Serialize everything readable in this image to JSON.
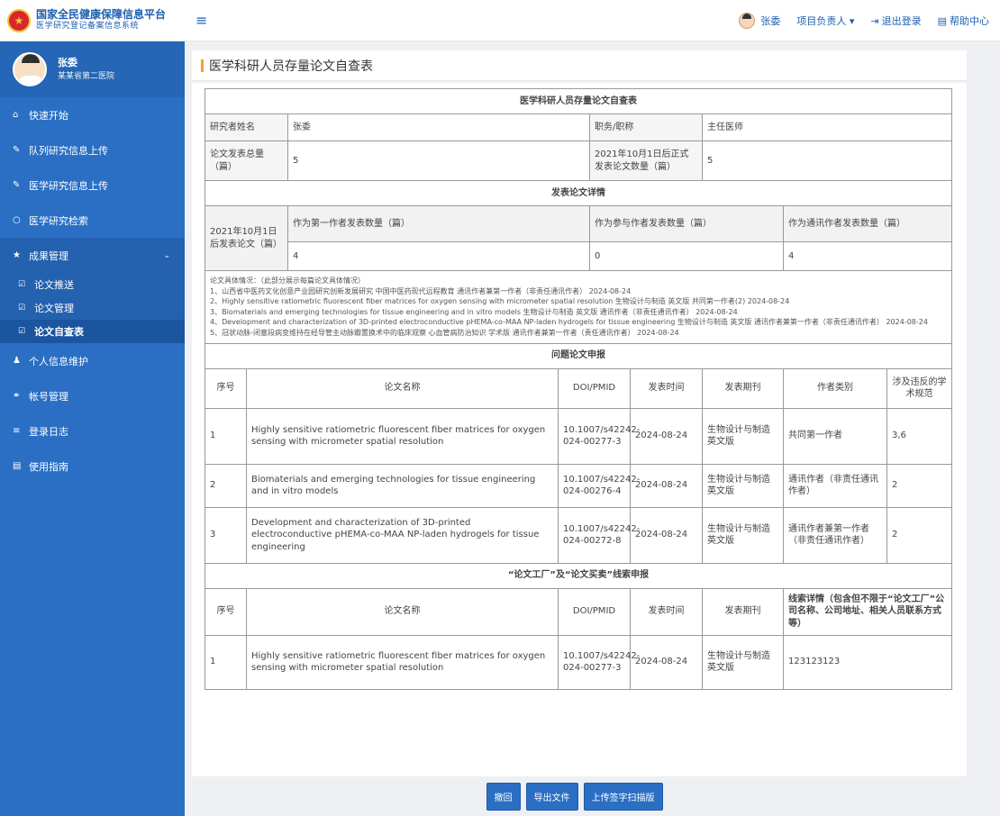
{
  "header": {
    "logo_title": "国家全民健康保障信息平台",
    "logo_sub": "医学研究登记备案信息系统",
    "user_name": "张委",
    "role_menu": "项目负责人",
    "logout": "退出登录",
    "help": "帮助中心"
  },
  "sidebar": {
    "profile_name": "张委",
    "profile_role": "某某省第二医院",
    "items": [
      {
        "label": "快速开始",
        "icon": "home-icon"
      },
      {
        "label": "队列研究信息上传",
        "icon": "pencil-icon"
      },
      {
        "label": "医学研究信息上传",
        "icon": "pencil-icon"
      },
      {
        "label": "医学研究检索",
        "icon": "circle-icon"
      },
      {
        "label": "成果管理",
        "icon": "star-icon"
      }
    ],
    "sub_items": [
      {
        "label": "论文推送"
      },
      {
        "label": "论文管理"
      },
      {
        "label": "论文自查表"
      }
    ],
    "items_after": [
      {
        "label": "个人信息维护",
        "icon": "user-icon"
      },
      {
        "label": "帐号管理",
        "icon": "users-icon"
      },
      {
        "label": "登录日志",
        "icon": "list-icon"
      },
      {
        "label": "使用指南",
        "icon": "book-icon"
      }
    ]
  },
  "page": {
    "title": "医学科研人员存量论文自查表"
  },
  "form": {
    "main_title": "医学科研人员存量论文自查表",
    "researcher_label": "研究者姓名",
    "researcher_value": "张委",
    "position_label": "职务/职称",
    "position_value": "主任医师",
    "total_label": "论文发表总量（篇）",
    "total_value": "5",
    "after_label": "2021年10月1日后正式发表论文数量（篇）",
    "after_value": "5",
    "details_title": "发表论文详情",
    "since_label": "2021年10月1日后发表论文（篇）",
    "first_author_label": "作为第一作者发表数量（篇）",
    "first_author_value": "4",
    "participant_label": "作为参与作者发表数量（篇）",
    "participant_value": "0",
    "corresponding_label": "作为通讯作者发表数量（篇）",
    "corresponding_value": "4",
    "detail_heading": "论文具体情况：（此部分展示每篇论文具体情况）",
    "detail_lines": [
      "1、山西省中医药文化创意产业园研究创新发展研究 中国中医药现代远程教育 通讯作者兼第一作者（非责任通讯作者） 2024-08-24",
      "2、Highly sensitive ratiometric fluorescent fiber matrices for oxygen sensing with micrometer spatial resolution 生物设计与制造 英文版 共同第一作者(2) 2024-08-24",
      "3、Biomaterials and emerging technologies for tissue engineering and in vitro models 生物设计与制造 英文版 通讯作者（非责任通讯作者） 2024-08-24",
      "4、Development and characterization of 3D-printed electroconductive pHEMA-co-MAA NP-laden hydrogels for tissue engineering 生物设计与制造 英文版 通讯作者兼第一作者（非责任通讯作者） 2024-08-24",
      "5、冠状动脉-闭塞段病变维持在经导管主动脉瓣置换术中的临床观察 心血管病防治知识 学术版 通讯作者兼第一作者（责任通讯作者） 2024-08-24"
    ],
    "problem_title": "问题论文申报",
    "problem_headers": [
      "序号",
      "论文名称",
      "DOI/PMID",
      "发表时间",
      "发表期刊",
      "作者类别",
      "涉及违反的学术规范"
    ],
    "problem_rows": [
      {
        "no": "1",
        "name": "Highly sensitive ratiometric fluorescent fiber matrices for oxygen sensing with micrometer spatial resolution",
        "doi": "10.1007/s42242-024-00277-3",
        "date": "2024-08-24",
        "journal": "生物设计与制造 英文版",
        "author": "共同第一作者",
        "rule": "3,6"
      },
      {
        "no": "2",
        "name": "Biomaterials and emerging technologies for tissue engineering and in vitro models",
        "doi": "10.1007/s42242-024-00276-4",
        "date": "2024-08-24",
        "journal": "生物设计与制造 英文版",
        "author": "通讯作者（非责任通讯作者）",
        "rule": "2"
      },
      {
        "no": "3",
        "name": "Development and characterization of 3D-printed electroconductive pHEMA-co-MAA NP-laden hydrogels for tissue engineering",
        "doi": "10.1007/s42242-024-00272-8",
        "date": "2024-08-24",
        "journal": "生物设计与制造 英文版",
        "author": "通讯作者兼第一作者（非责任通讯作者）",
        "rule": "2"
      }
    ],
    "clue_title": "“论文工厂”及“论文买卖”线索申报",
    "clue_headers": [
      "序号",
      "论文名称",
      "DOI/PMID",
      "发表时间",
      "发表期刊",
      "线索详情（包含但不限于“论文工厂”公司名称、公司地址、相关人员联系方式等）"
    ],
    "clue_rows": [
      {
        "no": "1",
        "name": "Highly sensitive ratiometric fluorescent fiber matrices for oxygen sensing with micrometer spatial resolution",
        "doi": "10.1007/s42242-024-00277-3",
        "date": "2024-08-24",
        "journal": "生物设计与制造 英文版",
        "detail": "123123123"
      }
    ]
  },
  "footer": {
    "back": "撤回",
    "export": "导出文件",
    "upload": "上传签字扫描版"
  }
}
